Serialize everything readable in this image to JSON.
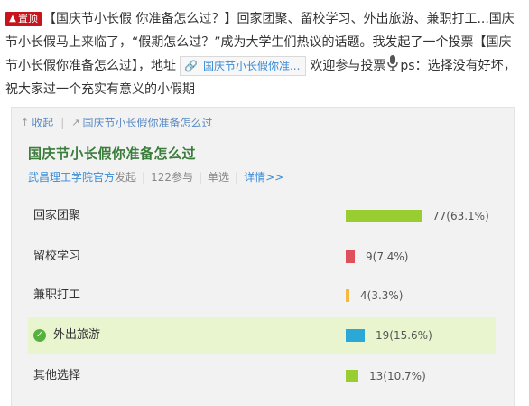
{
  "post": {
    "pin_label": "置顶",
    "topic": "【国庆节小长假 你准备怎么过？】",
    "text1": "回家团聚、留校学习、外出旅游、兼职打工...国庆节小长假马上来临了，“假期怎么过？”成为大学生们热议的话题。我发起了一个投票【国庆节小长假你准备怎么过】，地址",
    "link_label": "国庆节小长假你准...",
    "text2": "欢迎参与投票",
    "text3": "ps：选择没有好坏，祝大家过一个充实有意义的小假期"
  },
  "card": {
    "collapse_label": "收起",
    "link_label": "国庆节小长假你准备怎么过",
    "vote_title": "国庆节小长假你准备怎么过",
    "author": "武昌理工学院官方",
    "author_suffix": "发起",
    "participants": "122参与",
    "mode": "单选",
    "detail_label": "详情>>"
  },
  "options": [
    {
      "label": "回家团聚",
      "count_text": "77(63.1%)",
      "percent": 63.1,
      "color": "#9acd32",
      "selected": false
    },
    {
      "label": "留校学习",
      "count_text": "9(7.4%)",
      "percent": 7.4,
      "color": "#e0505a",
      "selected": false
    },
    {
      "label": "兼职打工",
      "count_text": "4(3.3%)",
      "percent": 3.3,
      "color": "#f5b942",
      "selected": false
    },
    {
      "label": "外出旅游",
      "count_text": "19(15.6%)",
      "percent": 15.6,
      "color": "#2aa8d8",
      "selected": true
    },
    {
      "label": "其他选择",
      "count_text": "13(10.7%)",
      "percent": 10.7,
      "color": "#9acd32",
      "selected": false
    }
  ]
}
